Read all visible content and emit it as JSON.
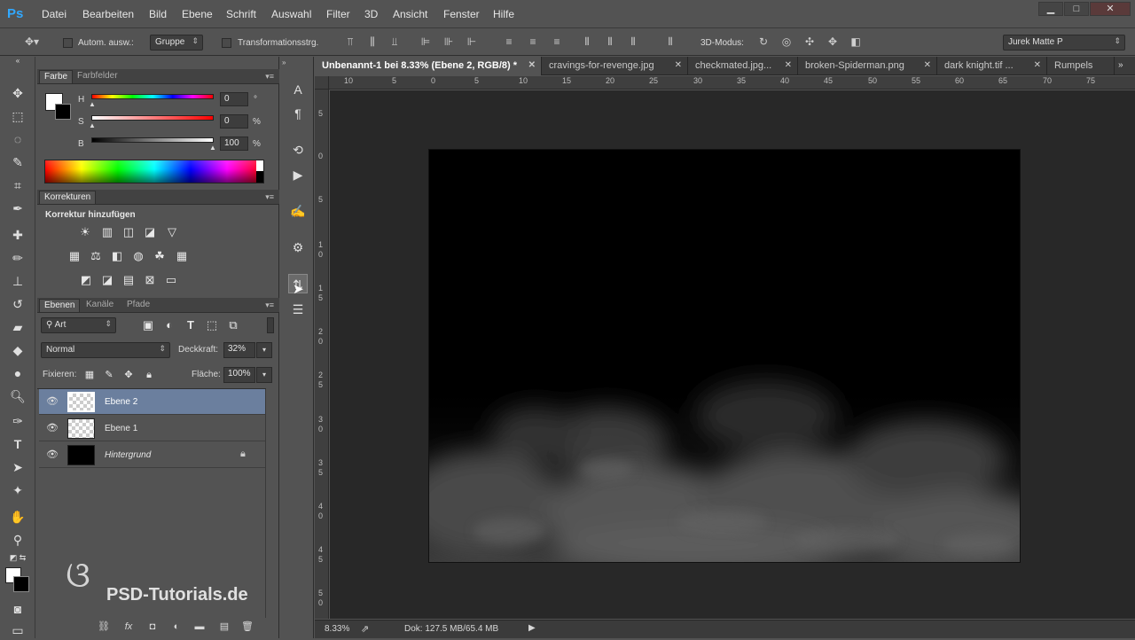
{
  "app": {
    "logo": "Ps"
  },
  "menu": [
    "Datei",
    "Bearbeiten",
    "Bild",
    "Ebene",
    "Schrift",
    "Auswahl",
    "Filter",
    "3D",
    "Ansicht",
    "Fenster",
    "Hilfe"
  ],
  "window_controls": {
    "minimize": "▁",
    "maximize": "□",
    "close": "✕"
  },
  "options": {
    "auto_select_label": "Autom. ausw.:",
    "auto_select_value": "Gruppe",
    "transform_label": "Transformationsstrg.",
    "mode_3d_label": "3D-Modus:",
    "workspace_value": "Jurek Matte P"
  },
  "color_panel": {
    "tabs": [
      "Farbe",
      "Farbfelder"
    ],
    "h_label": "H",
    "h_value": "0",
    "h_unit": "°",
    "s_label": "S",
    "s_value": "0",
    "s_unit": "%",
    "b_label": "B",
    "b_value": "100",
    "b_unit": "%"
  },
  "adjustments_panel": {
    "tabs": [
      "Korrekturen"
    ],
    "heading": "Korrektur hinzufügen"
  },
  "layers_panel": {
    "tabs": [
      "Ebenen",
      "Kanäle",
      "Pfade"
    ],
    "filter_kind": "Art",
    "blend_mode": "Normal",
    "opacity_label": "Deckkraft:",
    "opacity_value": "32%",
    "lock_label": "Fixieren:",
    "fill_label": "Fläche:",
    "fill_value": "100%",
    "layers": [
      {
        "name": "Ebene 2",
        "selected": true,
        "thumb": "transparent"
      },
      {
        "name": "Ebene 1",
        "selected": false,
        "thumb": "transparent"
      },
      {
        "name": "Hintergrund",
        "selected": false,
        "thumb": "black",
        "locked": true
      }
    ]
  },
  "document_tabs": [
    {
      "label": "Unbenannt-1 bei 8.33% (Ebene 2, RGB/8) *",
      "active": true
    },
    {
      "label": "cravings-for-revenge.jpg",
      "active": false
    },
    {
      "label": "checkmated.jpg...",
      "active": false
    },
    {
      "label": "broken-Spiderman.png",
      "active": false
    },
    {
      "label": "dark knight.tif ...",
      "active": false
    },
    {
      "label": "Rumpels",
      "active": false
    }
  ],
  "ruler_h": [
    "10",
    "5",
    "0",
    "5",
    "10",
    "15",
    "20",
    "25",
    "30",
    "35",
    "40",
    "45",
    "50",
    "55",
    "60",
    "65",
    "70",
    "75"
  ],
  "ruler_v": [
    "5",
    "0",
    "5",
    "10",
    "15",
    "20",
    "25",
    "30",
    "35",
    "40",
    "45",
    "50"
  ],
  "status": {
    "zoom": "8.33%",
    "doc": "Dok: 127.5 MB/65.4 MB"
  },
  "watermark": "PSD-Tutorials.de",
  "colors": {
    "accent": "#31a8ff",
    "selected_layer": "#6b7f9e",
    "panel_bg": "#535353",
    "workspace_bg": "#282828"
  }
}
